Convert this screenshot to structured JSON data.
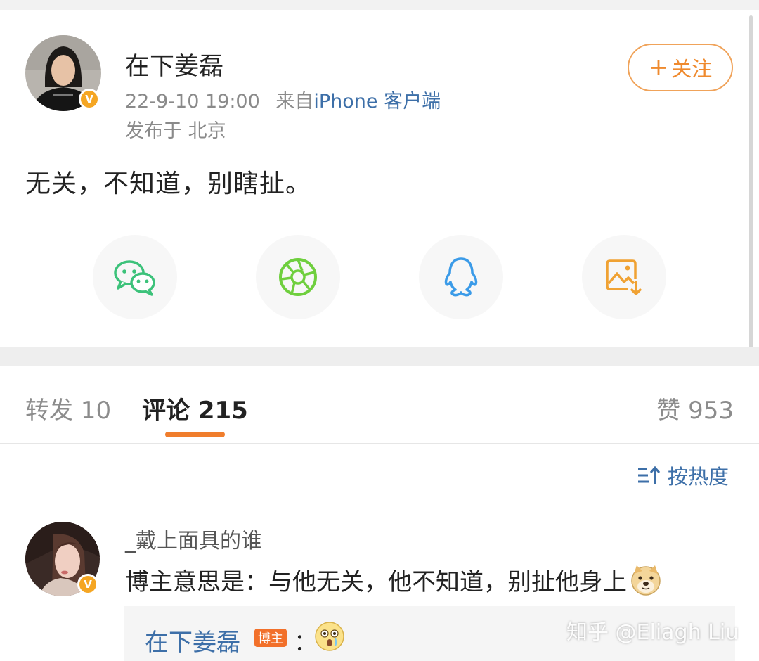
{
  "post": {
    "author": "在下姜磊",
    "timestamp": "22-9-10 19:00",
    "source_prefix": "来自",
    "source": "iPhone 客户端",
    "location": "发布于 北京",
    "follow_label": "关注",
    "follow_plus": "+",
    "text": "无关，不知道，别瞎扯。",
    "verified_badge": "V"
  },
  "share": {
    "items": [
      {
        "name": "wechat",
        "icon": "wechat-icon",
        "color": "#3cc27a"
      },
      {
        "name": "moments",
        "icon": "moments-icon",
        "color": "#6fcf3e"
      },
      {
        "name": "qq",
        "icon": "qq-icon",
        "color": "#3b9be8"
      },
      {
        "name": "save-image",
        "icon": "save-image-icon",
        "color": "#f0a233"
      }
    ]
  },
  "tabs": {
    "repost": "转发 10",
    "comments": "评论 215",
    "likes": "赞 953",
    "accent": "#f07d2c"
  },
  "sort": {
    "label": "按热度",
    "icon": "sort-icon"
  },
  "comments": [
    {
      "author": "_戴上面具的谁",
      "text": "博主意思是：与他无关，他不知道，别扯他身上",
      "emoji": "doge-emoji",
      "verified_badge": "V",
      "reply": {
        "author": "在下姜磊",
        "badge": "博主",
        "separator": "：",
        "emoji": "shocked-emoji"
      }
    }
  ],
  "watermark": "知乎 @Eliagh Liu"
}
